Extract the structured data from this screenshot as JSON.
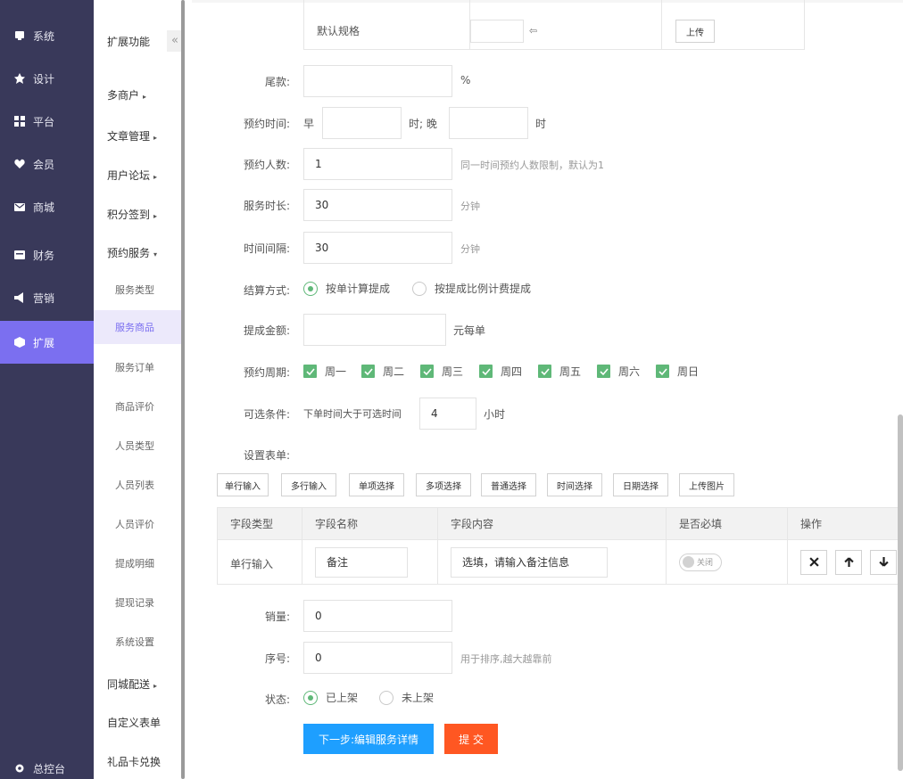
{
  "nav": {
    "items": [
      {
        "label": "系统",
        "icon": "monitor-icon"
      },
      {
        "label": "设计",
        "icon": "pin-icon"
      },
      {
        "label": "平台",
        "icon": "grid-icon"
      },
      {
        "label": "会员",
        "icon": "heart-icon"
      },
      {
        "label": "商城",
        "icon": "mail-icon"
      },
      {
        "label": "财务",
        "icon": "wallet-icon"
      },
      {
        "label": "营销",
        "icon": "megaphone-icon"
      },
      {
        "label": "扩展",
        "icon": "cube-icon"
      }
    ],
    "footer": {
      "label": "总控台",
      "icon": "gear-icon"
    }
  },
  "submenu": {
    "title": "扩展功能",
    "collapse": "«",
    "groups": [
      {
        "label": "多商户",
        "caret": "▸"
      },
      {
        "label": "文章管理",
        "caret": "▸"
      },
      {
        "label": "用户论坛",
        "caret": "▸"
      },
      {
        "label": "积分签到",
        "caret": "▸"
      },
      {
        "label": "预约服务",
        "caret": "▾"
      }
    ],
    "children": [
      "服务类型",
      "服务商品",
      "服务订单",
      "商品评价",
      "人员类型",
      "人员列表",
      "人员评价",
      "提成明细",
      "提现记录",
      "系统设置"
    ],
    "tail": [
      {
        "label": "同城配送",
        "caret": "▸"
      },
      {
        "label": "自定义表单",
        "caret": ""
      },
      {
        "label": "礼品卡兑换",
        "caret": ""
      }
    ]
  },
  "spec": {
    "label": "默认规格",
    "upload": "上传"
  },
  "form": {
    "balance": {
      "label": "尾款:",
      "value": "",
      "unit": "%"
    },
    "booking_time": {
      "label": "预约时间:",
      "early": "早",
      "mid": "时; 晚",
      "end": "时"
    },
    "booking_count": {
      "label": "预约人数:",
      "value": "1",
      "hint": "同一时间预约人数限制，默认为1"
    },
    "duration": {
      "label": "服务时长:",
      "value": "30",
      "unit": "分钟"
    },
    "interval": {
      "label": "时间间隔:",
      "value": "30",
      "unit": "分钟"
    },
    "settle": {
      "label": "结算方式:",
      "opt1": "按单计算提成",
      "opt2": "按提成比例计费提成"
    },
    "commission": {
      "label": "提成金额:",
      "value": "",
      "unit": "元每单"
    },
    "cycle": {
      "label": "预约周期:",
      "days": [
        "周一",
        "周二",
        "周三",
        "周四",
        "周五",
        "周六",
        "周日"
      ]
    },
    "condition": {
      "label": "可选条件:",
      "prefix": "下单时间大于可选时间",
      "value": "4",
      "unit": "小时"
    },
    "form_setting": {
      "label": "设置表单:"
    },
    "field_buttons": [
      "单行输入",
      "多行输入",
      "单项选择",
      "多项选择",
      "普通选择",
      "时间选择",
      "日期选择",
      "上传图片"
    ],
    "table": {
      "headers": [
        "字段类型",
        "字段名称",
        "字段内容",
        "是否必填",
        "操作"
      ],
      "row": {
        "type": "单行输入",
        "name": "备注",
        "content": "选填，请输入备注信息",
        "required": "关闭"
      }
    },
    "sales": {
      "label": "销量:",
      "value": "0"
    },
    "order": {
      "label": "序号:",
      "value": "0",
      "hint": "用于排序,越大越靠前"
    },
    "status": {
      "label": "状态:",
      "opt1": "已上架",
      "opt2": "未上架"
    },
    "next_button": "下一步:编辑服务详情",
    "submit_button": "提 交"
  },
  "colors": {
    "nav_bg": "#39395a",
    "nav_active": "#7b6ff0",
    "green": "#5fb878",
    "blue": "#1e9fff",
    "orange": "#ff5722"
  }
}
